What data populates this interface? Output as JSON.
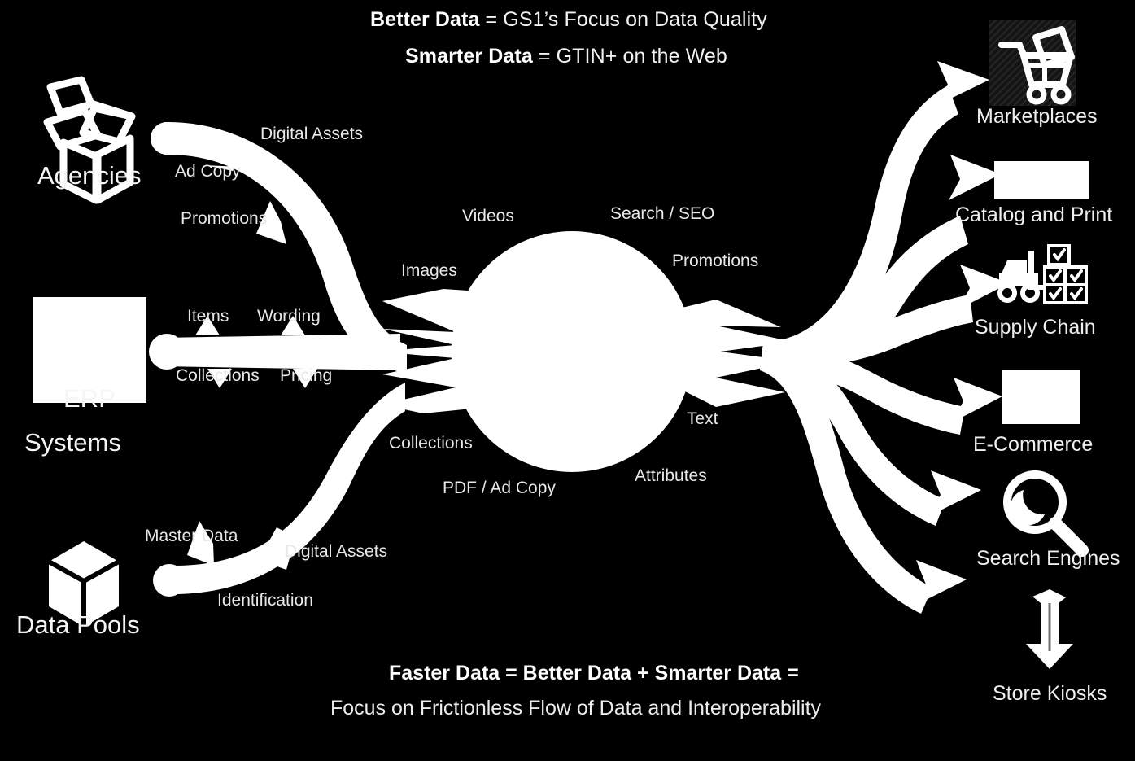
{
  "headline": {
    "line1_bold": "Better Data",
    "line1_rest": " = GS1’s Focus on Data Quality",
    "line2_bold": "Smarter Data",
    "line2_rest": " = GTIN+ on the Web"
  },
  "footer": {
    "line1": "Faster Data = Better Data + Smarter Data =",
    "line2": "Focus on Frictionless Flow of Data and Interoperability"
  },
  "sources": [
    {
      "label": "Agencies",
      "icon": "open-box-icon"
    },
    {
      "label": "ERP",
      "label2": "Systems",
      "icon": "blank-placeholder-icon"
    },
    {
      "label": "Data Pools",
      "icon": "cube-icon"
    }
  ],
  "inbound_labels": {
    "agencies": [
      "Digital Assets",
      "Ad Copy",
      "Promotions"
    ],
    "erp": [
      "Items",
      "Wording",
      "Collections",
      "Pricing"
    ],
    "datapools": [
      "Master Data",
      "Digital Assets",
      "Identification"
    ]
  },
  "hub_labels_left": [
    "Videos",
    "Images",
    "Collections",
    "PDF / Ad Copy"
  ],
  "hub_labels_right": [
    "Search / SEO",
    "Promotions",
    "Text",
    "Attributes"
  ],
  "destinations": [
    {
      "label": "Marketplaces",
      "icon": "shopping-cart-icon"
    },
    {
      "label": "Catalog and Print",
      "icon": "blank-placeholder-icon"
    },
    {
      "label": "Supply Chain",
      "icon": "forklift-pallet-icon"
    },
    {
      "label": "E-Commerce",
      "icon": "blank-placeholder-icon"
    },
    {
      "label": "Search Engines",
      "icon": "magnifier-icon"
    },
    {
      "label": "Store Kiosks",
      "icon": "down-arrow-icon"
    }
  ],
  "colors": {
    "background": "#000000",
    "foreground": "#ffffff",
    "label": "#e8e8e8"
  }
}
